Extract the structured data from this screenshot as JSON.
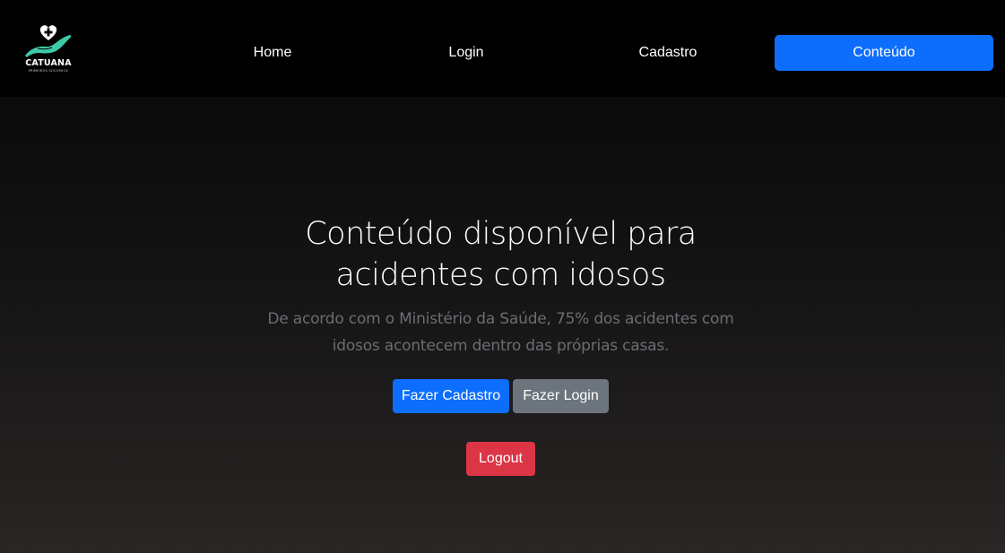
{
  "brand": {
    "name": "CATUANA",
    "tagline": "PRIMEIROS SOCORROS",
    "logo_icon": "hand-heart-cross-icon",
    "accent_color": "#3ec9a7"
  },
  "nav": {
    "items": [
      {
        "label": "Home"
      },
      {
        "label": "Login"
      },
      {
        "label": "Cadastro"
      },
      {
        "label": "Conteúdo",
        "active": true
      }
    ],
    "active_color": "#0d6efd"
  },
  "hero": {
    "title": "Conteúdo disponível para acidentes com idosos",
    "subtitle": "De acordo com o Ministério da Saúde, 75% dos acidentes com idosos acontecem dentro das próprias casas.",
    "buttons": {
      "signup_label": "Fazer Cadastro",
      "login_label": "Fazer Login",
      "logout_label": "Logout"
    }
  },
  "colors": {
    "primary": "#0d6efd",
    "secondary": "#6c757d",
    "danger": "#dc3545"
  }
}
